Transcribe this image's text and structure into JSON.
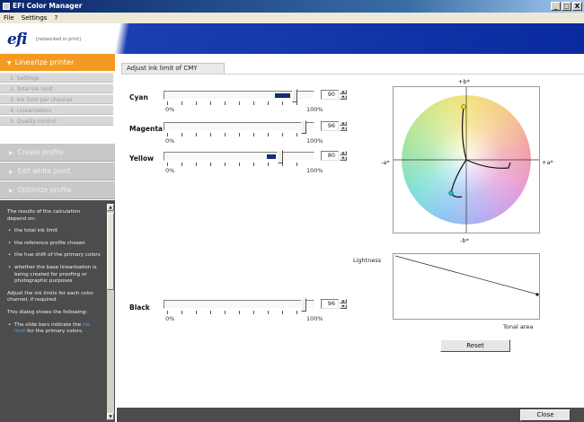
{
  "window": {
    "title": "EFI Color Manager",
    "controls": [
      "_",
      "□",
      "X"
    ]
  },
  "menubar": {
    "items": [
      "File",
      "Settings",
      "?"
    ]
  },
  "brand": {
    "logo": "efi",
    "tagline": "[networked in print]"
  },
  "sidebar": {
    "active_step": "Linearize printer",
    "substeps": [
      "1. Settings",
      "2. Total ink limit",
      "3. Ink limit per channel",
      "4. Linearization",
      "5. Quality control"
    ],
    "steps": [
      "Create profile",
      "Edit white point",
      "Optimize profile"
    ],
    "help": {
      "intro": "The results of the calculation depend on:",
      "bullets": [
        "the total ink limit",
        "the reference profile chosen",
        "the hue shift of the primary colors",
        "whether the base linearization is being created for proofing or photographic purposes"
      ],
      "para1": "Adjust the ink limits for each color channel, if required.",
      "para2": "This dialog shows the following:",
      "bullet_last_pre": "The slide bars indicate the",
      "bullet_last_link": "ink limit",
      "bullet_last_post": "for the primary colors."
    }
  },
  "main": {
    "tab_label": "Adjust ink limit of CMY",
    "min_label": "0%",
    "max_label": "100%",
    "channels": [
      {
        "name": "Cyan",
        "value": "90",
        "limit": 0.9,
        "fill_start": 0.78
      },
      {
        "name": "Magenta",
        "value": "96",
        "limit": 0.96,
        "fill_start": null
      },
      {
        "name": "Yellow",
        "value": "80",
        "limit": 0.8,
        "fill_start": 0.72
      },
      {
        "name": "Black",
        "value": "96",
        "limit": 0.96,
        "fill_start": null
      }
    ]
  },
  "plot": {
    "top_label": "+b*",
    "bottom_label": "-b*",
    "left_label": "-a*",
    "right_label": "+a*",
    "lightness_label": "Lightness",
    "tonal_label": "Tonal area"
  },
  "buttons": {
    "reset": "Reset",
    "close": "Close"
  },
  "colors": {
    "accent": "#f59a20",
    "brand_blue": "#0b2aa0",
    "slider_fill": "#1a2a6e",
    "help_bg": "#4c4c4c"
  }
}
